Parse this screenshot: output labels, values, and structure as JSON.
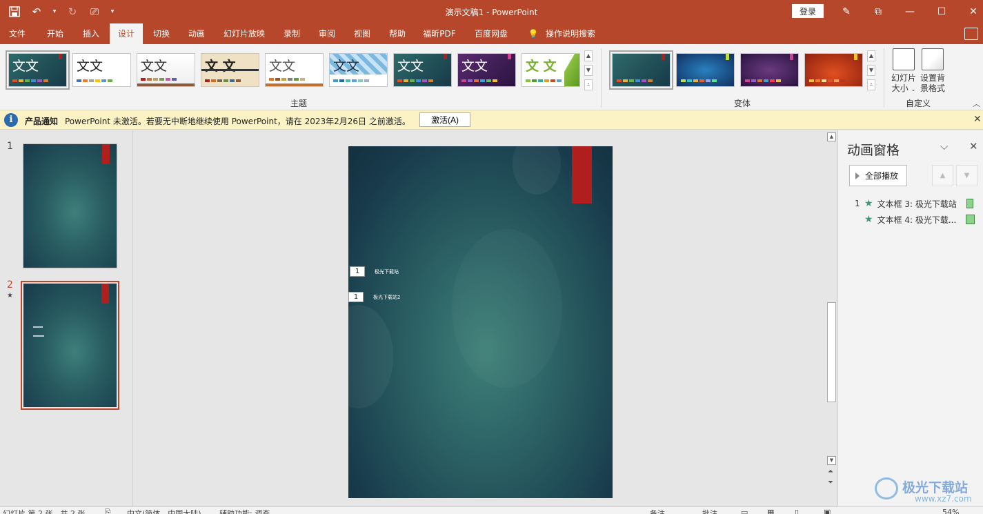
{
  "window": {
    "title": "演示文稿1  -  PowerPoint",
    "login": "登录"
  },
  "tabs": [
    "文件",
    "开始",
    "插入",
    "设计",
    "切换",
    "动画",
    "幻灯片放映",
    "录制",
    "审阅",
    "视图",
    "帮助",
    "福昕PDF",
    "百度网盘",
    "操作说明搜索"
  ],
  "active_tab": "设计",
  "ribbon": {
    "theme_label": "主题",
    "variant_label": "变体",
    "custom_label": "自定义",
    "theme_text": "文文",
    "theme_text_alt": "文 文",
    "slide_size": "幻灯片\n大小",
    "slide_size_l1": "幻灯片",
    "slide_size_l2": "大小",
    "bg_format_l1": "设置背",
    "bg_format_l2": "景格式"
  },
  "notification": {
    "label": "产品通知",
    "message": "PowerPoint 未激活。若要无中断地继续使用 PowerPoint，请在 2023年2月26日 之前激活。",
    "button": "激活(A)"
  },
  "thumbnails": [
    {
      "number": "1",
      "star": ""
    },
    {
      "number": "2",
      "star": "★"
    }
  ],
  "slide": {
    "items": [
      {
        "tag": "1",
        "text": "极光下载站"
      },
      {
        "tag": "1",
        "text": "极光下载站2"
      }
    ]
  },
  "animation_pane": {
    "title": "动画窗格",
    "play_all": "全部播放",
    "items": [
      {
        "number": "1",
        "label": "文本框 3: 极光下载站"
      },
      {
        "number": "",
        "label": "文本框 4: 极光下载..."
      }
    ]
  },
  "status": {
    "slide": "幻灯片 第 2 张，共 2 张",
    "language": "中文(简体，中国大陆)",
    "accessibility": "辅助功能: 调查",
    "notes": "备注",
    "comments": "批注",
    "zoom": "54%"
  },
  "watermark": {
    "text": "极光下载站",
    "url": "www.xz7.com"
  },
  "colors": {
    "accent": "#b7472a",
    "notify_bg": "#fbf3c5",
    "slide_red": "#b01e1e"
  }
}
